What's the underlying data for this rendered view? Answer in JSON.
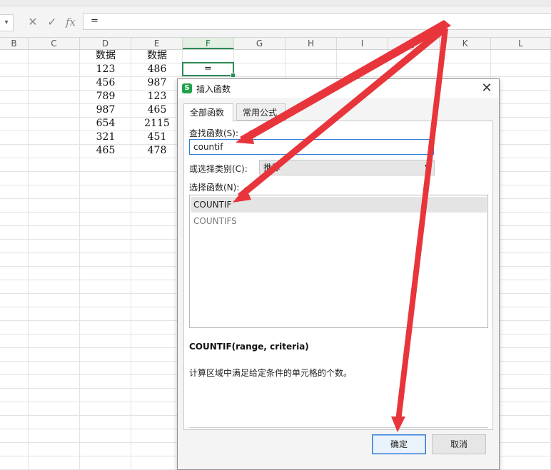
{
  "formula_bar": {
    "cancel_icon": "✕",
    "confirm_icon": "✓",
    "fx_label": "fx",
    "formula_value": "="
  },
  "sheet": {
    "columns": [
      "B",
      "C",
      "D",
      "E",
      "F",
      "G",
      "H",
      "I",
      "J",
      "K",
      "L"
    ],
    "active_column": "F",
    "header_row": {
      "D": "数据",
      "E": "数据"
    },
    "rows": [
      {
        "D": "123",
        "E": "486"
      },
      {
        "D": "456",
        "E": "987"
      },
      {
        "D": "789",
        "E": "123"
      },
      {
        "D": "987",
        "E": "465"
      },
      {
        "D": "654",
        "E": "2115"
      },
      {
        "D": "321",
        "E": "451"
      },
      {
        "D": "465",
        "E": "478"
      }
    ],
    "active_cell_value": "="
  },
  "dialog": {
    "app_logo": "S",
    "title": "插入函数",
    "close_icon": "✕",
    "tabs": [
      {
        "label": "全部函数",
        "active": true
      },
      {
        "label": "常用公式",
        "active": false
      }
    ],
    "search_label": "查找函数(S):",
    "search_value": "countif",
    "category_label": "或选择类别(C):",
    "category_value": "推荐",
    "list_label": "选择函数(N):",
    "functions": [
      {
        "name": "COUNTIF",
        "selected": true
      },
      {
        "name": "COUNTIFS",
        "selected": false
      }
    ],
    "syntax": "COUNTIF(range, criteria)",
    "description": "计算区域中满足给定条件的单元格的个数。",
    "ok_label": "确定",
    "cancel_label": "取消"
  },
  "colors": {
    "accent_green": "#2e8b57",
    "focus_blue": "#2f7ed8",
    "annotation_red": "#e8353b"
  }
}
